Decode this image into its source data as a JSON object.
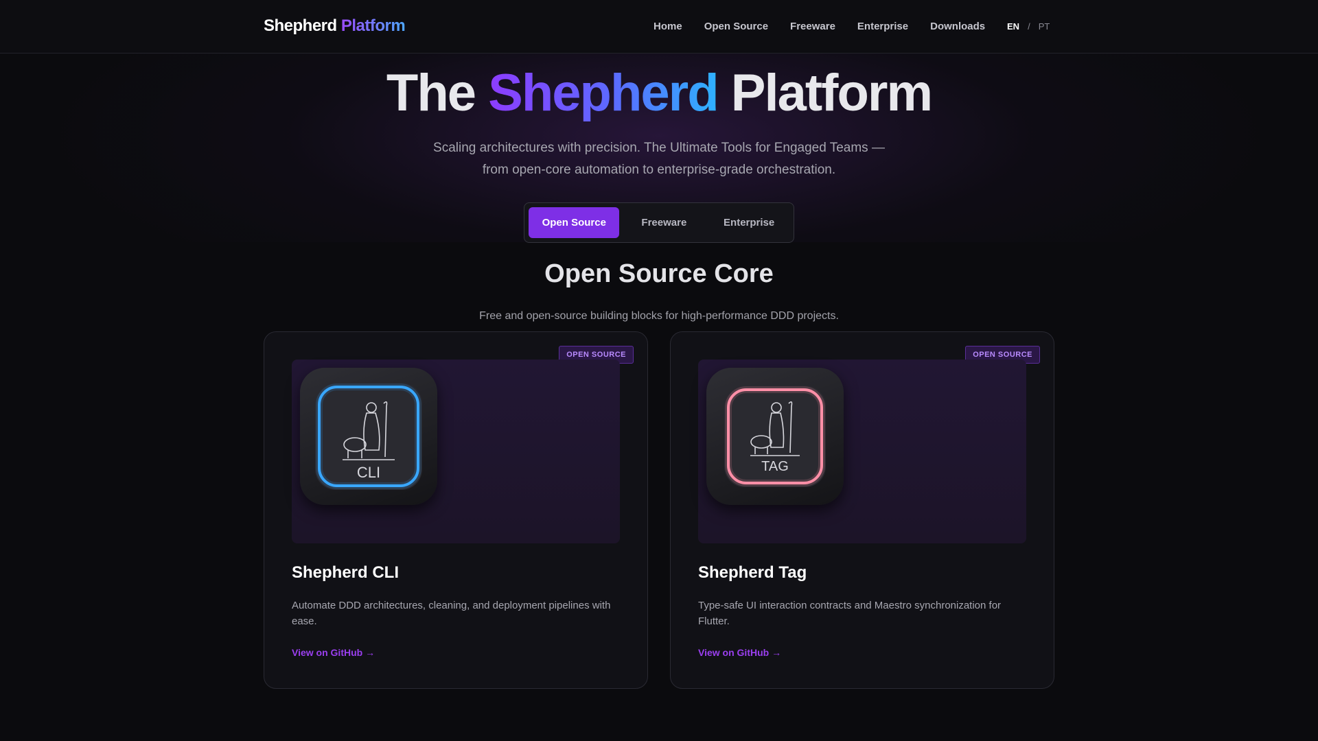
{
  "header": {
    "logo_main": "Shepherd",
    "logo_accent": "Platform",
    "nav": [
      "Home",
      "Open Source",
      "Freeware",
      "Enterprise",
      "Downloads"
    ],
    "lang_active": "EN",
    "lang_sep": "/",
    "lang_other": "PT"
  },
  "hero": {
    "title_pre": "The",
    "title_accent": "Shepherd",
    "title_post": "Platform",
    "subtitle_line1": "Scaling architectures with precision. The Ultimate Tools for Engaged Teams —",
    "subtitle_line2": "from open-core automation to enterprise-grade orchestration."
  },
  "tabs": {
    "items": [
      "Open Source",
      "Freeware",
      "Enterprise"
    ],
    "selected": "Open Source"
  },
  "section": {
    "title": "Open Source Core",
    "subtitle": "Free and open-source building blocks for high-performance DDD projects."
  },
  "cards": [
    {
      "badge": "OPEN SOURCE",
      "icon_label": "CLI",
      "icon_glow": "#3aa8ff",
      "title": "Shepherd CLI",
      "description": "Automate DDD architectures, cleaning, and deployment pipelines with ease.",
      "link": "View on GitHub →"
    },
    {
      "badge": "OPEN SOURCE",
      "icon_label": "TAG",
      "icon_glow": "#ff8fa8",
      "title": "Shepherd Tag",
      "description": "Type-safe UI interaction contracts and Maestro synchronization for Flutter.",
      "link": "View on GitHub →"
    }
  ],
  "colors": {
    "accent": "#7e2fe6",
    "link": "#9b3ff0",
    "background": "#0b0b0e"
  }
}
